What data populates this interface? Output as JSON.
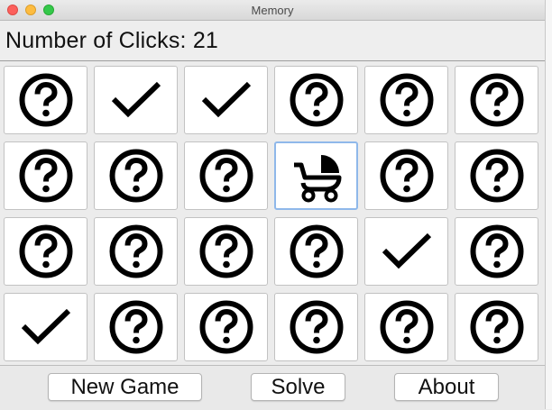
{
  "window": {
    "title": "Memory"
  },
  "header": {
    "clicks_label": "Number of Clicks: ",
    "clicks_value": "21"
  },
  "grid": {
    "rows": [
      [
        "question-icon",
        "check-icon",
        "check-icon",
        "question-icon",
        "question-icon",
        "question-icon"
      ],
      [
        "question-icon",
        "question-icon",
        "question-icon",
        "stroller-icon",
        "question-icon",
        "question-icon"
      ],
      [
        "question-icon",
        "question-icon",
        "question-icon",
        "question-icon",
        "check-icon",
        "question-icon"
      ],
      [
        "check-icon",
        "question-icon",
        "question-icon",
        "question-icon",
        "question-icon",
        "question-icon"
      ]
    ],
    "selected_cell": {
      "row": 1,
      "col": 3
    }
  },
  "buttons": {
    "new_game": "New Game",
    "solve": "Solve",
    "about": "About"
  },
  "colors": {
    "selected_border": "#8fb8ea",
    "background": "#ececec"
  }
}
